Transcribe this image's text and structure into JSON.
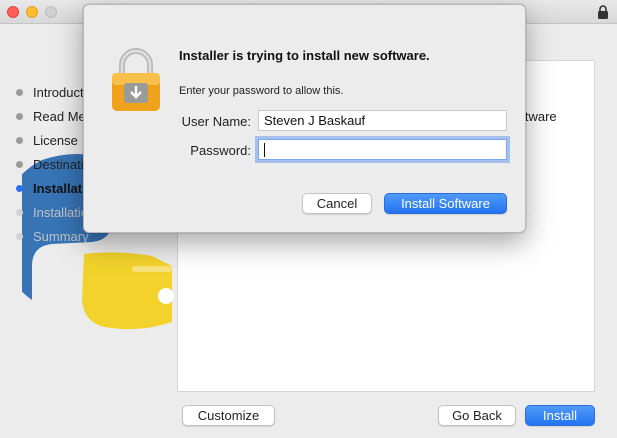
{
  "installer": {
    "steps": [
      {
        "label": "Introduction",
        "state": "done"
      },
      {
        "label": "Read Me",
        "state": "done"
      },
      {
        "label": "License",
        "state": "done"
      },
      {
        "label": "Destination Select",
        "state": "done"
      },
      {
        "label": "Installation Type",
        "state": "active"
      },
      {
        "label": "Installation",
        "state": "future"
      },
      {
        "label": "Summary",
        "state": "future"
      }
    ],
    "content_text": "oftware",
    "buttons": {
      "customize": "Customize",
      "go_back": "Go Back",
      "install": "Install"
    }
  },
  "dialog": {
    "title": "Installer is trying to install new software.",
    "message": "Enter your password to allow this.",
    "user_name_label": "User Name:",
    "user_name_value": "Steven J Baskauf",
    "password_label": "Password:",
    "password_value": "",
    "cancel_label": "Cancel",
    "install_software_label": "Install Software"
  },
  "colors": {
    "accent": "#2b6ef2",
    "primary_button": "#2473f0",
    "close": "#fe5f57",
    "minimize": "#febc2e"
  },
  "icons": {
    "dialog_icon": "padlock-installer-icon",
    "titlebar_icon": "lock-icon",
    "background_logo": "python-logo"
  }
}
